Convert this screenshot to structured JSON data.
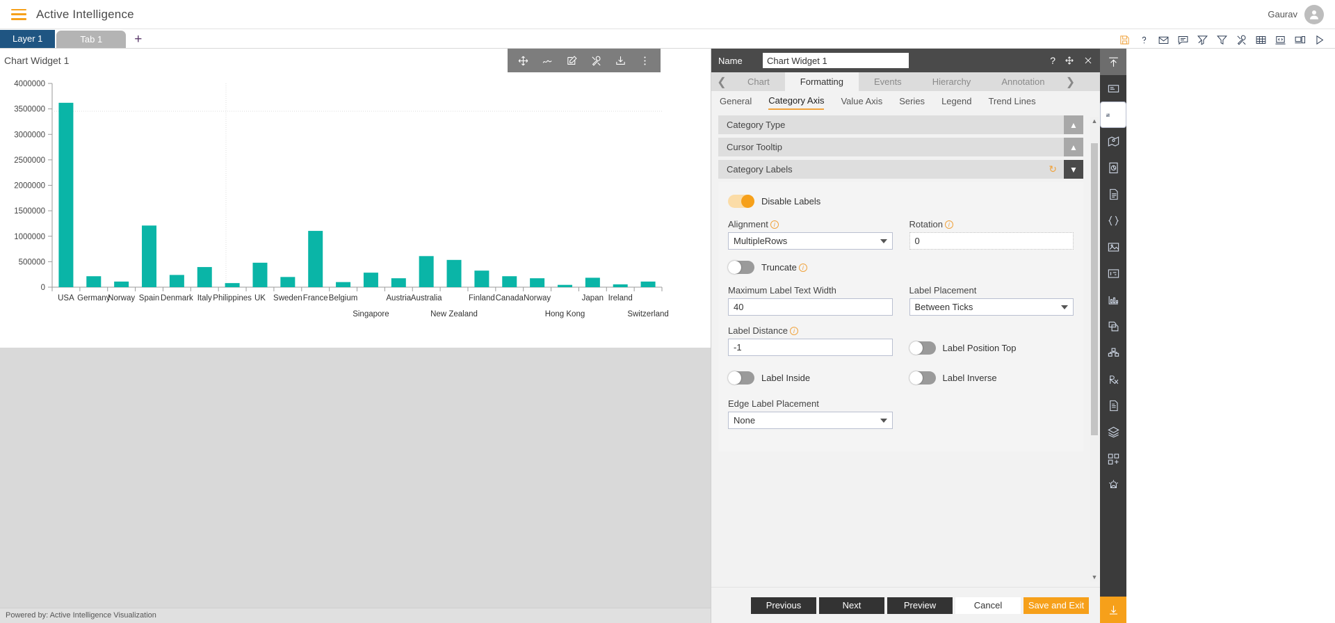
{
  "topbar": {
    "menu_icon": "hamburger-icon",
    "app_title": "Active Intelligence",
    "user_name": "Gaurav",
    "avatar_icon": "user-avatar-icon"
  },
  "tabstrip": {
    "layer_tab": "Layer 1",
    "page_tab": "Tab 1",
    "add_tab": "+",
    "tools": [
      {
        "name": "save-icon",
        "title": "Save"
      },
      {
        "name": "help-icon",
        "title": "Help"
      },
      {
        "name": "mail-icon",
        "title": "Mail"
      },
      {
        "name": "comment-icon",
        "title": "Comment"
      },
      {
        "name": "clear-filter-icon",
        "title": "Clear Filter"
      },
      {
        "name": "filter-icon",
        "title": "Filter"
      },
      {
        "name": "tools-icon",
        "title": "Tools"
      },
      {
        "name": "table-icon",
        "title": "Table"
      },
      {
        "name": "code-icon",
        "title": "Code"
      },
      {
        "name": "devices-icon",
        "title": "Devices"
      },
      {
        "name": "play-icon",
        "title": "Run"
      }
    ]
  },
  "widget": {
    "title": "Chart Widget 1",
    "toolbar": [
      {
        "name": "move-icon",
        "title": "Move"
      },
      {
        "name": "scribble-icon",
        "title": "Annotate"
      },
      {
        "name": "edit-icon",
        "title": "Edit"
      },
      {
        "name": "tools-icon",
        "title": "Settings"
      },
      {
        "name": "download-icon",
        "title": "Export"
      },
      {
        "name": "more-vertical-icon",
        "title": "More"
      }
    ]
  },
  "chart_data": {
    "type": "bar",
    "title": "Chart Widget 1",
    "xlabel": "",
    "ylabel": "",
    "ylim": [
      0,
      4000000
    ],
    "yticks": [
      0,
      500000,
      1000000,
      1500000,
      2000000,
      2500000,
      3000000,
      3500000,
      4000000
    ],
    "ytick_labels": [
      "0",
      "500000",
      "1000000",
      "1500000",
      "2000000",
      "2500000",
      "3000000",
      "3500000",
      "4000000"
    ],
    "grid": false,
    "legend": "none",
    "bar_color": "#0ab5a7",
    "categories": [
      "USA",
      "Germany",
      "Norway",
      "Spain",
      "Denmark",
      "Italy",
      "Philippines",
      "UK",
      "Sweden",
      "France",
      "Belgium",
      "Singapore",
      "Austria",
      "Australia",
      "New Zealand",
      "Finland",
      "Canada",
      "Norway",
      "Hong Kong",
      "Japan",
      "Ireland",
      "Switzerland"
    ],
    "values": [
      3620000,
      215000,
      110000,
      1210000,
      240000,
      395000,
      80000,
      480000,
      200000,
      1105000,
      100000,
      285000,
      175000,
      610000,
      535000,
      325000,
      215000,
      175000,
      45000,
      185000,
      55000,
      110000
    ]
  },
  "footer": {
    "powered_by": "Powered by: Active Intelligence Visualization"
  },
  "panel": {
    "name_label": "Name",
    "name_value": "Chart Widget 1",
    "header_actions": [
      {
        "name": "help-icon",
        "glyph": "?"
      },
      {
        "name": "move-icon",
        "glyph": "move"
      },
      {
        "name": "close-icon",
        "glyph": "close"
      }
    ],
    "tabs": [
      {
        "label": "Chart",
        "active": false
      },
      {
        "label": "Formatting",
        "active": true
      },
      {
        "label": "Events",
        "active": false
      },
      {
        "label": "Hierarchy",
        "active": false
      },
      {
        "label": "Annotation",
        "active": false
      }
    ],
    "tab_prev_icon": "chevron-left-icon",
    "tab_next_icon": "chevron-right-icon",
    "subtabs": [
      {
        "label": "General",
        "active": false
      },
      {
        "label": "Category Axis",
        "active": true
      },
      {
        "label": "Value Axis",
        "active": false
      },
      {
        "label": "Series",
        "active": false
      },
      {
        "label": "Legend",
        "active": false
      },
      {
        "label": "Trend Lines",
        "active": false
      }
    ],
    "accordions": [
      {
        "title": "Category Type",
        "open": false
      },
      {
        "title": "Cursor Tooltip",
        "open": false
      },
      {
        "title": "Category Labels",
        "open": true
      }
    ],
    "form": {
      "disable_labels_label": "Disable Labels",
      "disable_labels_on": true,
      "alignment_label": "Alignment",
      "alignment_value": "MultipleRows",
      "rotation_label": "Rotation",
      "rotation_value": "0",
      "truncate_label": "Truncate",
      "truncate_on": false,
      "max_label_text_width_label": "Maximum Label Text Width",
      "max_label_text_width_value": "40",
      "label_placement_label": "Label Placement",
      "label_placement_value": "Between Ticks",
      "label_distance_label": "Label Distance",
      "label_distance_value": "-1",
      "label_position_top_label": "Label Position Top",
      "label_position_top_on": false,
      "label_inside_label": "Label Inside",
      "label_inside_on": false,
      "label_inverse_label": "Label Inverse",
      "label_inverse_on": false,
      "edge_label_placement_label": "Edge Label Placement",
      "edge_label_placement_value": "None"
    },
    "buttons": {
      "previous": "Previous",
      "next": "Next",
      "preview": "Preview",
      "cancel": "Cancel",
      "save_and_exit": "Save and Exit"
    }
  },
  "rail": [
    {
      "name": "collapse-up-icon",
      "style": "top"
    },
    {
      "name": "panel-icon",
      "style": ""
    },
    {
      "name": "chart-icon",
      "style": "sel"
    },
    {
      "name": "map-icon",
      "style": ""
    },
    {
      "name": "pie-report-icon",
      "style": ""
    },
    {
      "name": "document-icon",
      "style": ""
    },
    {
      "name": "braces-icon",
      "style": ""
    },
    {
      "name": "image-icon",
      "style": ""
    },
    {
      "name": "info-card-icon",
      "style": ""
    },
    {
      "name": "bar-small-icon",
      "style": ""
    },
    {
      "name": "copy-page-icon",
      "style": ""
    },
    {
      "name": "cubes-icon",
      "style": ""
    },
    {
      "name": "prescription-icon",
      "style": ""
    },
    {
      "name": "notes-icon",
      "style": ""
    },
    {
      "name": "layers-icon",
      "style": ""
    },
    {
      "name": "add-grid-icon",
      "style": ""
    },
    {
      "name": "alert-bell-icon",
      "style": ""
    },
    {
      "name": "download-icon",
      "style": "bottom"
    }
  ],
  "colors": {
    "accent": "#f6a01a",
    "bar": "#0ab5a7",
    "layer_tab": "#1f5582",
    "dark": "#4a4a4a"
  }
}
